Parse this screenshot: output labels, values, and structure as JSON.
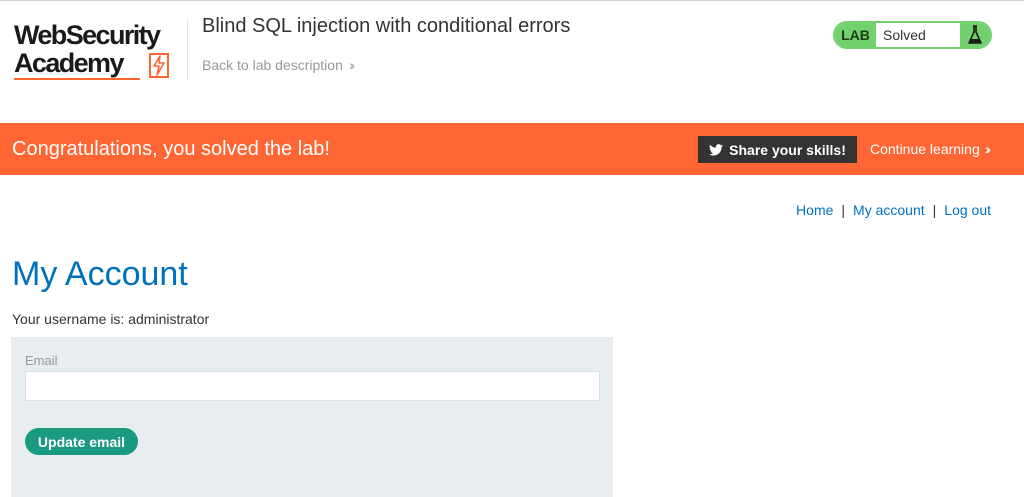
{
  "brand": {
    "line1": "WebSecurity",
    "line2": "Academy",
    "accent_color": "#ff6633",
    "icon": "lightning-bolt-icon"
  },
  "header": {
    "lab_title": "Blind SQL injection with conditional errors",
    "back_link": "Back to lab description",
    "status_badge": "LAB",
    "status_text": "Solved",
    "status_color": "#70d16d",
    "status_icon": "flask-icon"
  },
  "banner": {
    "message": "Congratulations, you solved the lab!",
    "share_label": "Share your skills!",
    "share_icon": "twitter-icon",
    "continue_label": "Continue learning",
    "background": "#ff6633"
  },
  "nav": {
    "home": "Home",
    "my_account": "My account",
    "log_out": "Log out",
    "separator": "|"
  },
  "main": {
    "title": "My Account",
    "username_prefix": "Your username is: ",
    "username": "administrator",
    "email_label": "Email",
    "email_value": "",
    "update_button": "Update email"
  }
}
